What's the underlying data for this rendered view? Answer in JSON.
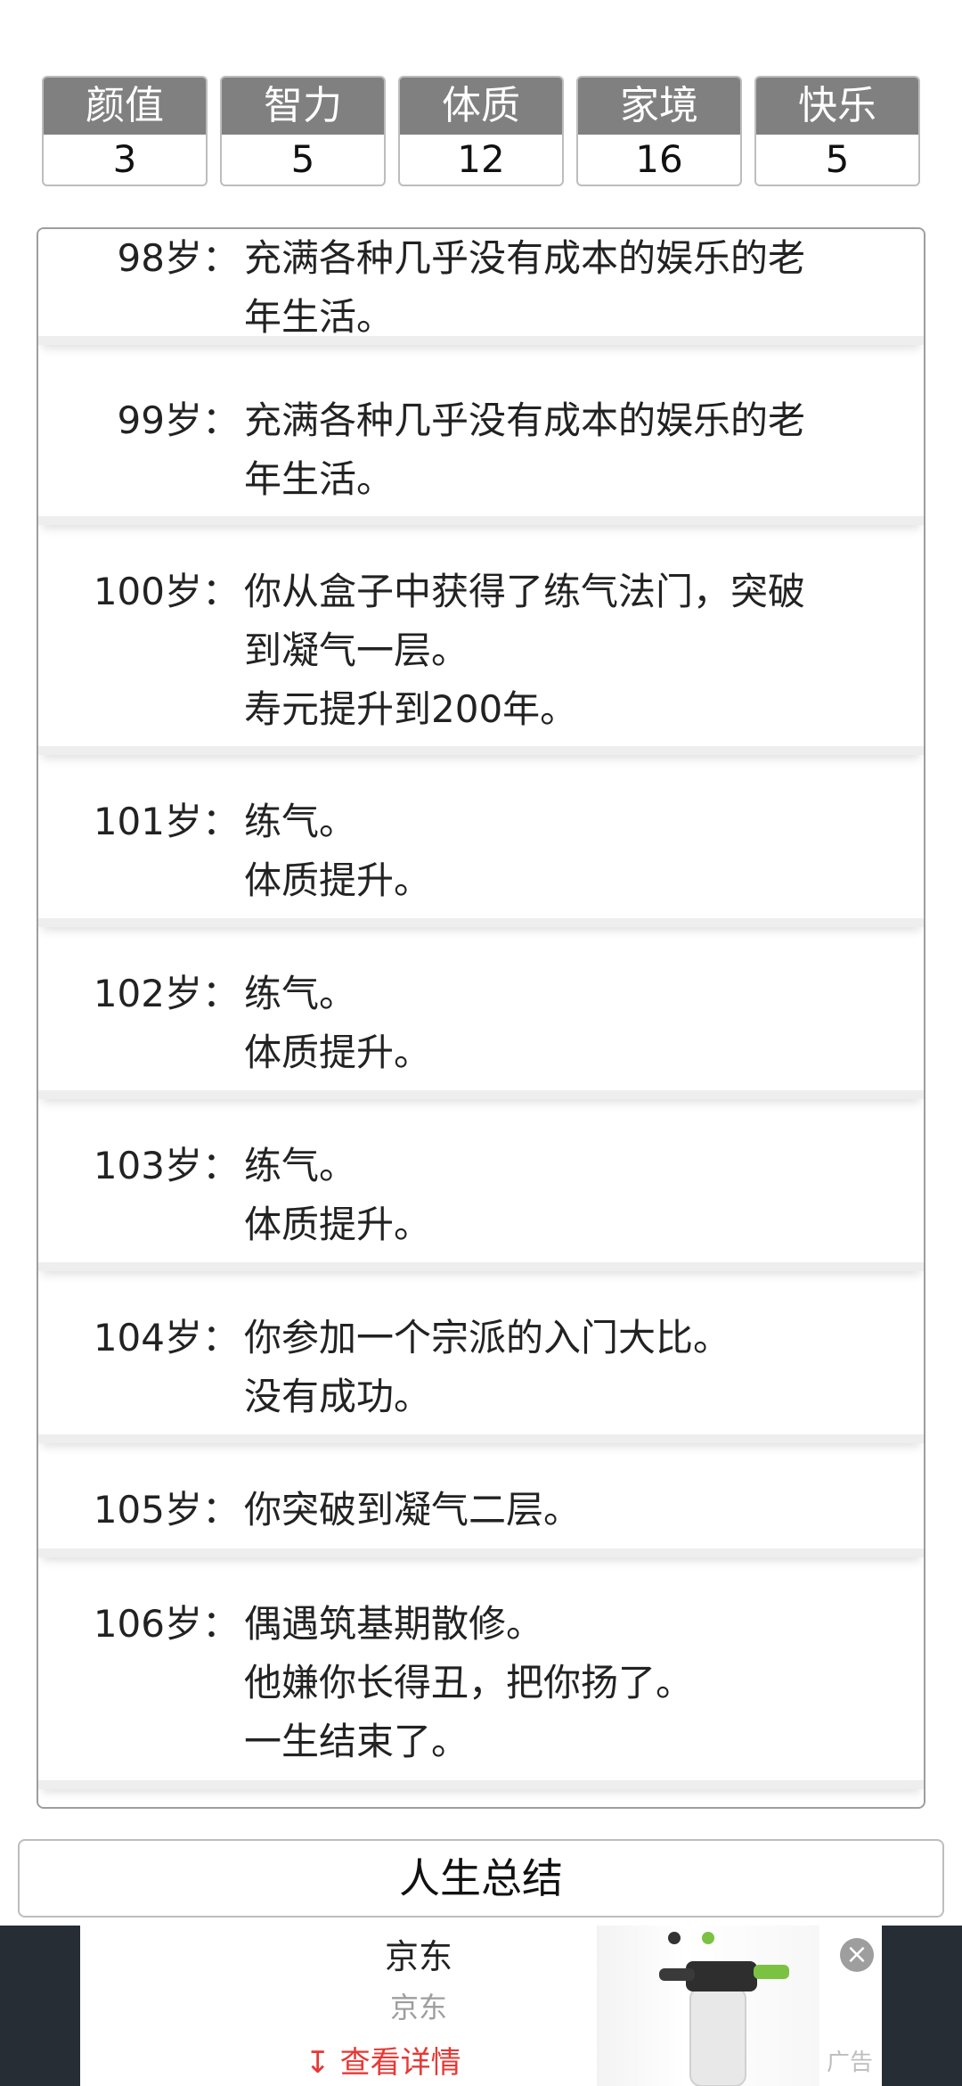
{
  "stats": [
    {
      "label": "颜值",
      "value": "3"
    },
    {
      "label": "智力",
      "value": "5"
    },
    {
      "label": "体质",
      "value": "12"
    },
    {
      "label": "家境",
      "value": "16"
    },
    {
      "label": "快乐",
      "value": "5"
    }
  ],
  "log": [
    {
      "age": "98岁：",
      "lines": [
        "充满各种几乎没有成本的娱乐的老",
        "年生活。"
      ]
    },
    {
      "age": "99岁：",
      "lines": [
        "充满各种几乎没有成本的娱乐的老",
        "年生活。"
      ]
    },
    {
      "age": "100岁：",
      "lines": [
        "你从盒子中获得了练气法门，突破",
        "到凝气一层。",
        "寿元提升到200年。"
      ]
    },
    {
      "age": "101岁：",
      "lines": [
        "练气。",
        "体质提升。"
      ]
    },
    {
      "age": "102岁：",
      "lines": [
        "练气。",
        "体质提升。"
      ]
    },
    {
      "age": "103岁：",
      "lines": [
        "练气。",
        "体质提升。"
      ]
    },
    {
      "age": "104岁：",
      "lines": [
        "你参加一个宗派的入门大比。",
        "没有成功。"
      ]
    },
    {
      "age": "105岁：",
      "lines": [
        "你突破到凝气二层。"
      ]
    },
    {
      "age": "106岁：",
      "lines": [
        "偶遇筑基期散修。",
        "他嫌你长得丑，把你扬了。",
        "一生结束了。"
      ]
    }
  ],
  "summary_button": "人生总结",
  "ad": {
    "title": "京东",
    "subtitle": "京东",
    "cta": "查看详情",
    "cta_icon": "download-arrow-icon",
    "close_icon": "close-icon",
    "tag": "广告"
  },
  "colors": {
    "stat_header": "#808080",
    "ad_cta": "#e53935",
    "ad_background": "#262d34"
  }
}
